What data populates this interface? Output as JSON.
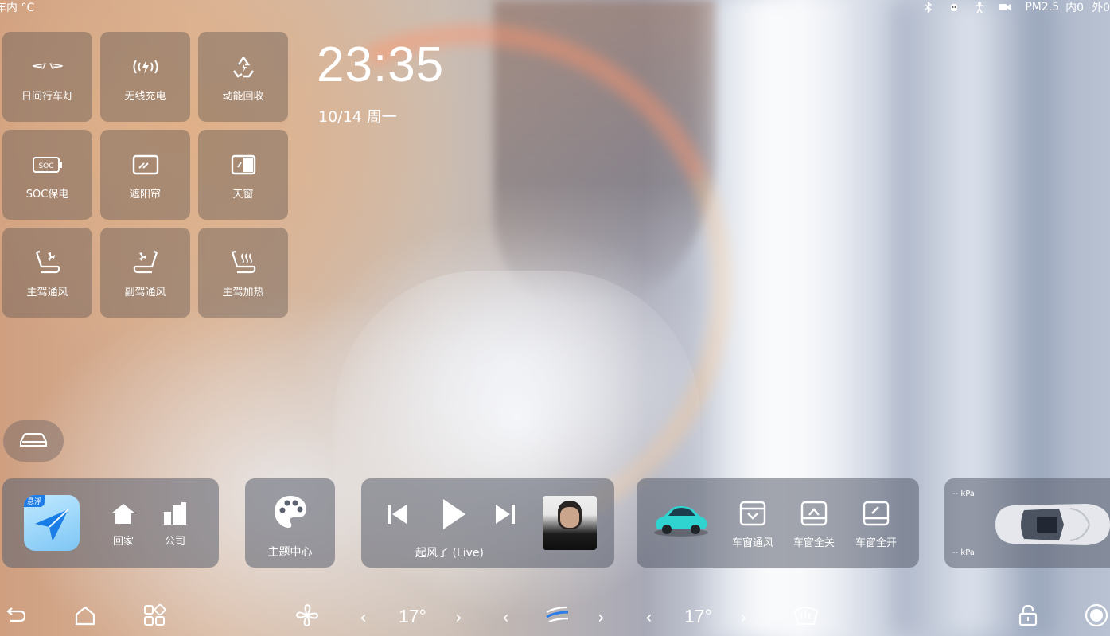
{
  "status": {
    "left_text": "车内 °C",
    "pm25_label": "PM2.5",
    "inside_label": "内0",
    "outside_label": "外0"
  },
  "tiles": [
    {
      "label": "日间行车灯",
      "icon": "daytime-running-light-icon"
    },
    {
      "label": "无线充电",
      "icon": "wireless-charging-icon"
    },
    {
      "label": "动能回收",
      "icon": "energy-recovery-icon"
    },
    {
      "label": "SOC保电",
      "icon": "soc-battery-icon"
    },
    {
      "label": "遮阳帘",
      "icon": "sunshade-icon"
    },
    {
      "label": "天窗",
      "icon": "sunroof-icon"
    },
    {
      "label": "主驾通风",
      "icon": "driver-seat-ventilation-icon"
    },
    {
      "label": "副驾通风",
      "icon": "passenger-seat-ventilation-icon"
    },
    {
      "label": "主驾加热",
      "icon": "driver-seat-heating-icon"
    }
  ],
  "clock": {
    "time": "23:35",
    "date": "10/14 周一"
  },
  "nav": {
    "badge": "悬浮",
    "home_label": "回家",
    "work_label": "公司"
  },
  "theme": {
    "label": "主题中心"
  },
  "media": {
    "song_title": "起风了 (Live)"
  },
  "car_controls": {
    "vent_label": "车窗通风",
    "close_label": "车窗全关",
    "open_label": "车窗全开"
  },
  "tire": {
    "front_value": "--",
    "rear_value": "--",
    "unit": "kPa"
  },
  "climate": {
    "left_temp": "17°",
    "right_temp": "17°"
  },
  "colors": {
    "accent": "#2fd3d0",
    "tile_bg": "rgba(95,85,80,0.42)",
    "card_bg": "rgba(90,95,110,0.55)"
  }
}
